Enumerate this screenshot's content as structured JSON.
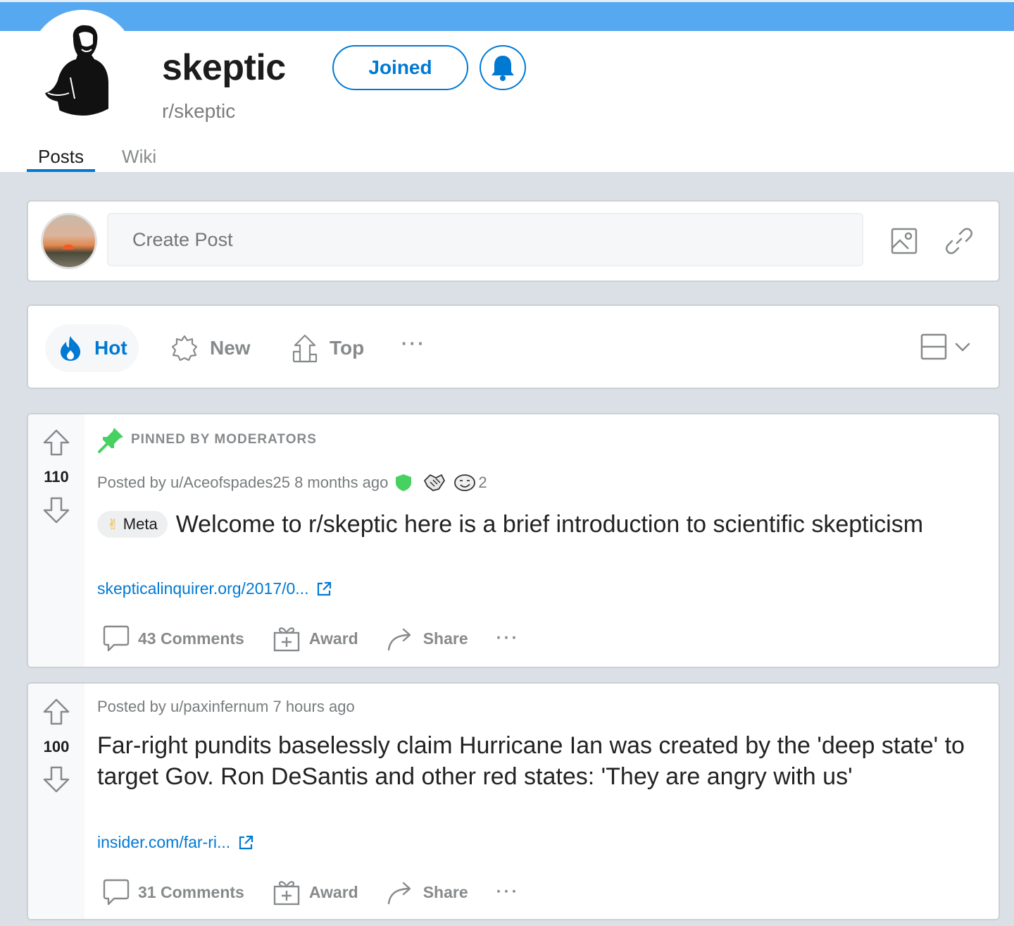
{
  "colors": {
    "banner": "#56a8f1",
    "accent": "#0079d3",
    "background": "#dae0e6",
    "pin": "#46d160"
  },
  "community": {
    "name": "skeptic",
    "handle": "r/skeptic",
    "joined_label": "Joined"
  },
  "tabs": [
    {
      "label": "Posts",
      "active": true
    },
    {
      "label": "Wiki",
      "active": false
    }
  ],
  "create_post": {
    "placeholder": "Create Post"
  },
  "sort": {
    "hot": "Hot",
    "new": "New",
    "top": "Top",
    "more": "···"
  },
  "posts": [
    {
      "pinned_label": "PINNED BY MODERATORS",
      "votes": "110",
      "posted_by": "Posted by u/Aceofspades25 8 months ago",
      "award_count": "2",
      "flair": "Meta",
      "title": "Welcome to r/skeptic here is a brief introduction to scientific skepticism",
      "link": "skepticalinquirer.org/2017/0...",
      "comments": "43 Comments",
      "award": "Award",
      "share": "Share",
      "more": "···"
    },
    {
      "votes": "100",
      "posted_by": "Posted by u/paxinfernum 7 hours ago",
      "title": "Far-right pundits baselessly claim Hurricane Ian was created by the 'deep state' to target Gov. Ron DeSantis and other red states: 'They are angry with us'",
      "link": "insider.com/far-ri...",
      "comments": "31 Comments",
      "award": "Award",
      "share": "Share",
      "more": "···"
    }
  ]
}
